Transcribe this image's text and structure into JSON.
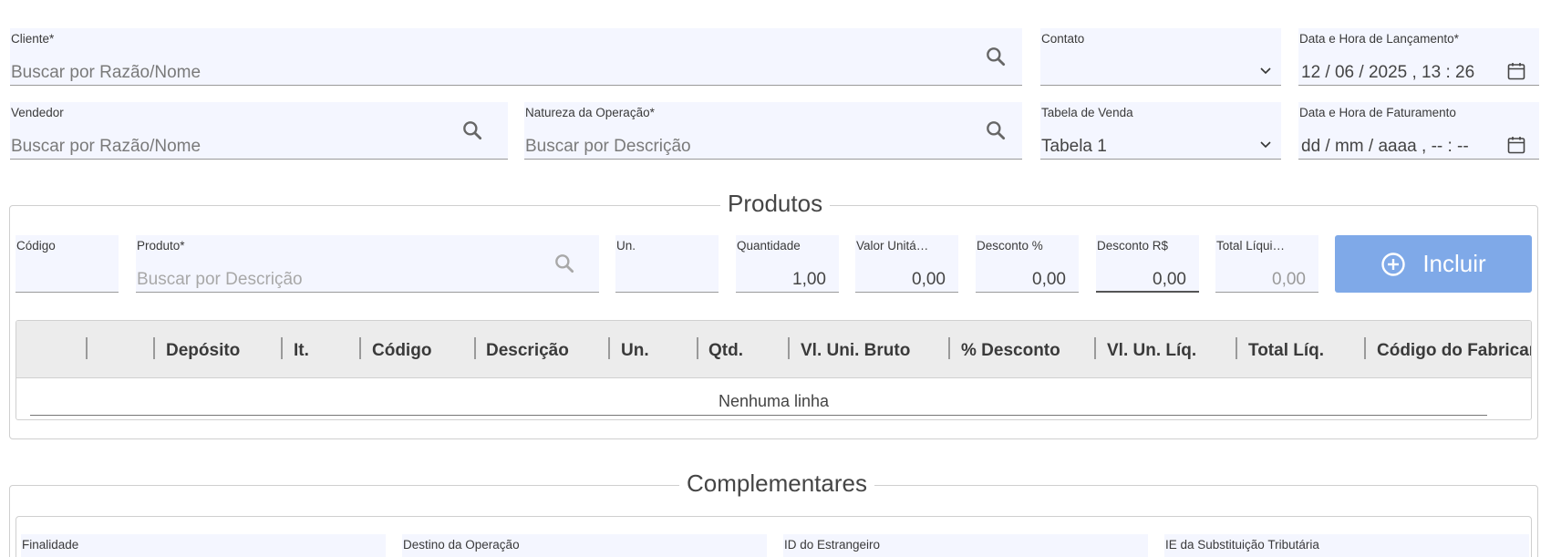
{
  "header": {
    "cliente": {
      "label": "Cliente*",
      "placeholder": "Buscar por Razão/Nome"
    },
    "contato": {
      "label": "Contato",
      "value": ""
    },
    "data_lancamento": {
      "label": "Data e Hora de Lançamento*",
      "value": "12 / 06 / 2025 ,  13 : 26"
    },
    "vendedor": {
      "label": "Vendedor",
      "placeholder": "Buscar por Razão/Nome"
    },
    "natureza": {
      "label": "Natureza da Operação*",
      "placeholder": "Buscar por Descrição"
    },
    "tabela_venda": {
      "label": "Tabela de Venda",
      "value": "Tabela 1"
    },
    "data_faturamento": {
      "label": "Data e Hora de Faturamento",
      "value": "dd / mm / aaaa ,  -- : --"
    }
  },
  "produtos": {
    "legend": "Produtos",
    "codigo": {
      "label": "Código",
      "value": ""
    },
    "produto": {
      "label": "Produto*",
      "placeholder": "Buscar por Descrição"
    },
    "un": {
      "label": "Un.",
      "value": ""
    },
    "quantidade": {
      "label": "Quantidade",
      "value": "1,00"
    },
    "valor_unitario": {
      "label": "Valor Unitá…",
      "value": "0,00"
    },
    "desconto_pct": {
      "label": "Desconto %",
      "value": "0,00"
    },
    "desconto_rs": {
      "label": "Desconto R$",
      "value": "0,00"
    },
    "total_liquido": {
      "label": "Total Líqui…",
      "value": "0,00"
    },
    "incluir_label": "Incluir",
    "grid": {
      "columns": [
        "Depósito",
        "It.",
        "Código",
        "Descrição",
        "Un.",
        "Qtd.",
        "Vl. Uni. Bruto",
        "% Desconto",
        "Vl. Un. Líq.",
        "Total Líq.",
        "Código do Fabricante"
      ],
      "empty_text": "Nenhuma linha"
    }
  },
  "complementares": {
    "legend": "Complementares",
    "finalidade": {
      "label": "Finalidade"
    },
    "destino": {
      "label": "Destino da Operação"
    },
    "id_estrangeiro": {
      "label": "ID do Estrangeiro"
    },
    "ie_st": {
      "label": "IE da Substituição Tributária"
    }
  },
  "colors": {
    "field_bg": "#f4f6ff",
    "button": "#7fa9e8",
    "grid_header": "#ececec"
  }
}
